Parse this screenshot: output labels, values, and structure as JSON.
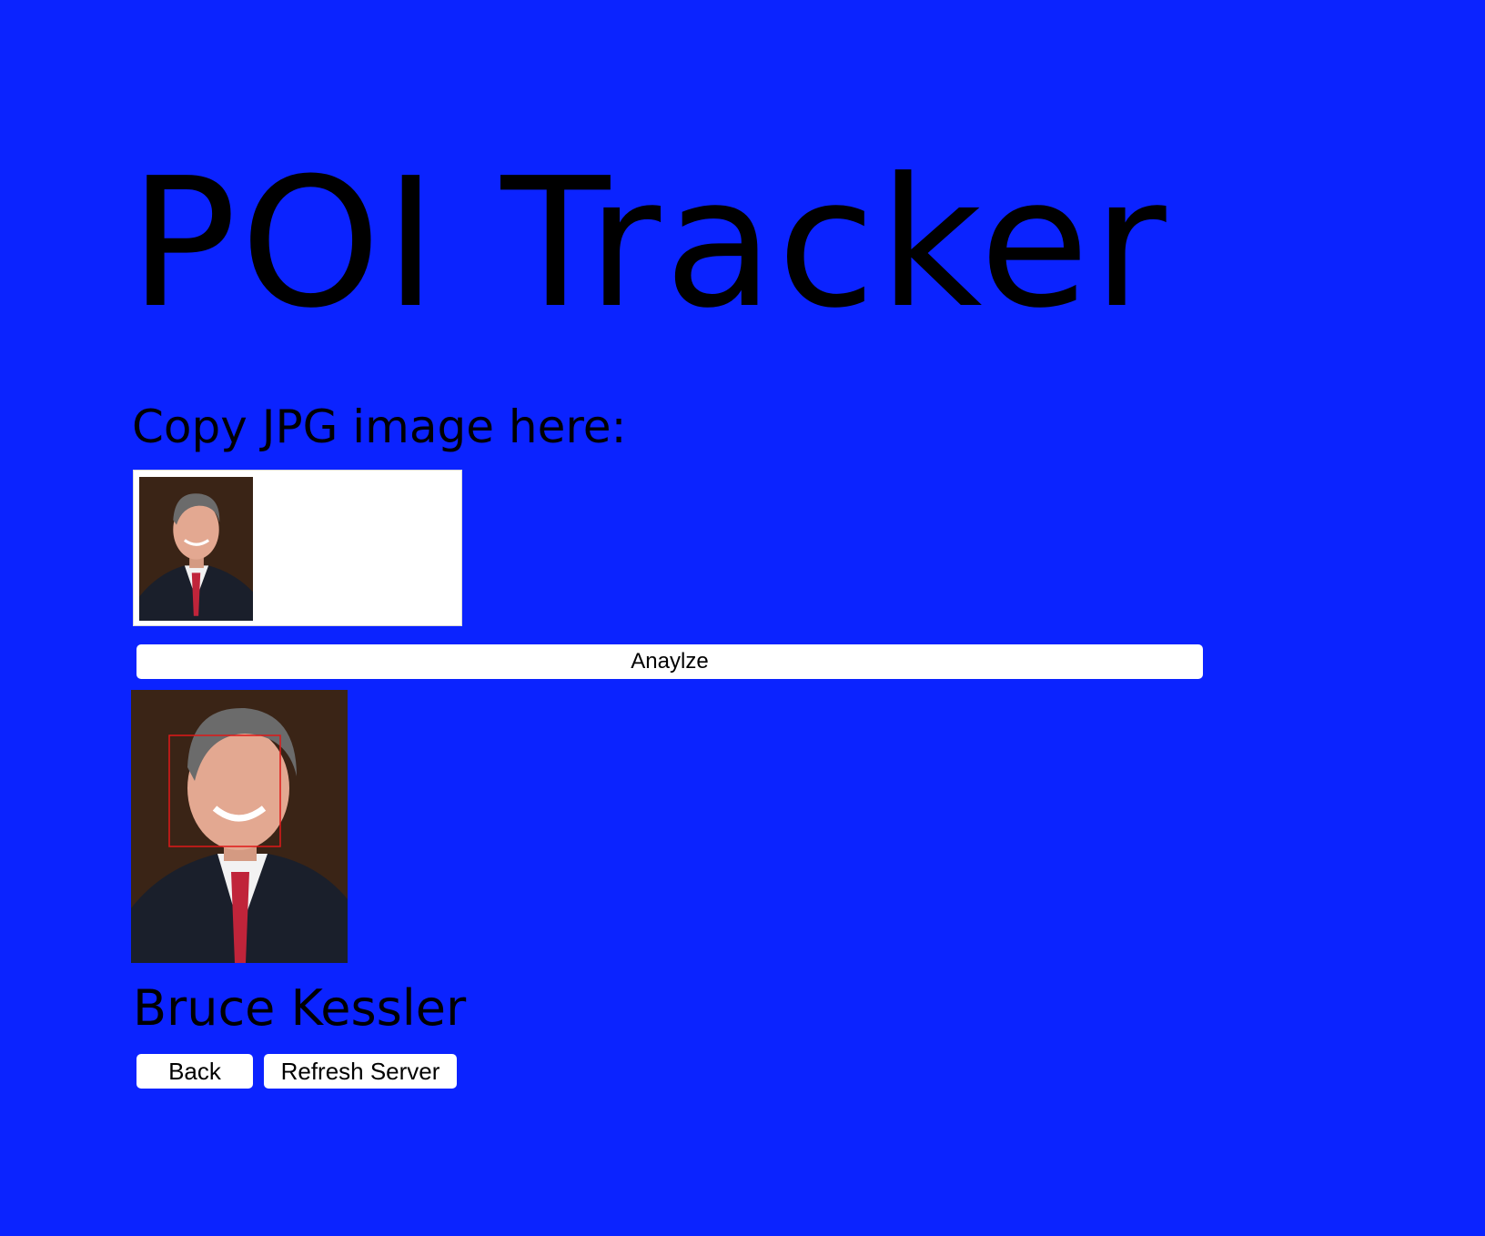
{
  "app": {
    "title": "POI Tracker"
  },
  "upload": {
    "label": "Copy JPG image here:",
    "thumbnail_icon": "portrait-photo-icon"
  },
  "actions": {
    "analyze_label": "Anaylze",
    "back_label": "Back",
    "refresh_label": "Refresh Server"
  },
  "result": {
    "photo_icon": "portrait-photo-icon",
    "face_box_color": "#e01818",
    "name": "Bruce Kessler"
  },
  "colors": {
    "background": "#0b23ff",
    "button_bg": "#ffffff",
    "text": "#000000"
  }
}
